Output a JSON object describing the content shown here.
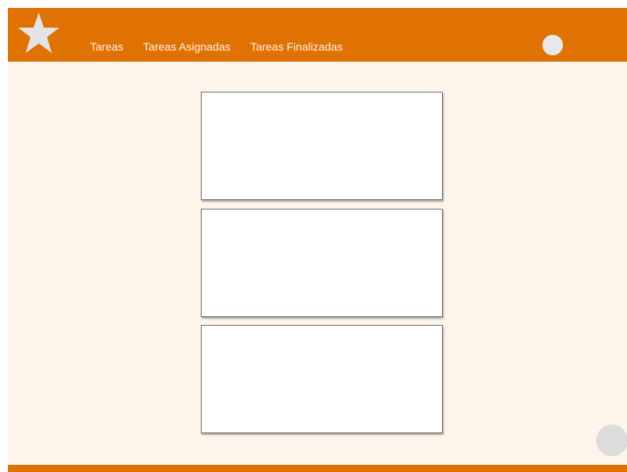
{
  "header": {
    "logo_icon": "star-icon",
    "nav": [
      {
        "label": "Tareas"
      },
      {
        "label": "Tareas Asignadas"
      },
      {
        "label": "Tareas Finalizadas"
      }
    ],
    "avatar_icon": "avatar-circle"
  },
  "main": {
    "cards": [
      {
        "content": ""
      },
      {
        "content": ""
      },
      {
        "content": ""
      }
    ]
  },
  "fab_icon": "circle-button",
  "colors": {
    "accent": "#e07204",
    "background": "#fdf4ea",
    "nav_text": "#fff3e6",
    "avatar": "#e8e8ea"
  }
}
